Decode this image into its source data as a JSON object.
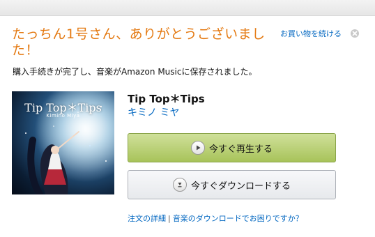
{
  "header": {
    "thanks_message": "たっちん1号さん、ありがとうございました！",
    "continue_shopping": "お買い物を続ける"
  },
  "confirmation": {
    "message": "購入手続きが完了し、音楽がAmazon Musicに保存されました。"
  },
  "album": {
    "title": "Tip Top＊Tips",
    "artist": "キミノ ミヤ",
    "cover_title": "Tip Top＊Tips",
    "cover_artist": "Kimino Miya"
  },
  "actions": {
    "play_label": "今すぐ再生する",
    "download_label": "今すぐダウンロードする"
  },
  "footer": {
    "order_details": "注文の詳細",
    "separator": "|",
    "download_help": "音楽のダウンロードでお困りですか？"
  },
  "colors": {
    "accent_orange": "#e47911",
    "link_blue": "#0066c0",
    "play_button": "#b6d06e",
    "download_button": "#eceef1"
  },
  "icons": {
    "close": "close-icon",
    "play": "play-icon",
    "download": "download-icon"
  }
}
